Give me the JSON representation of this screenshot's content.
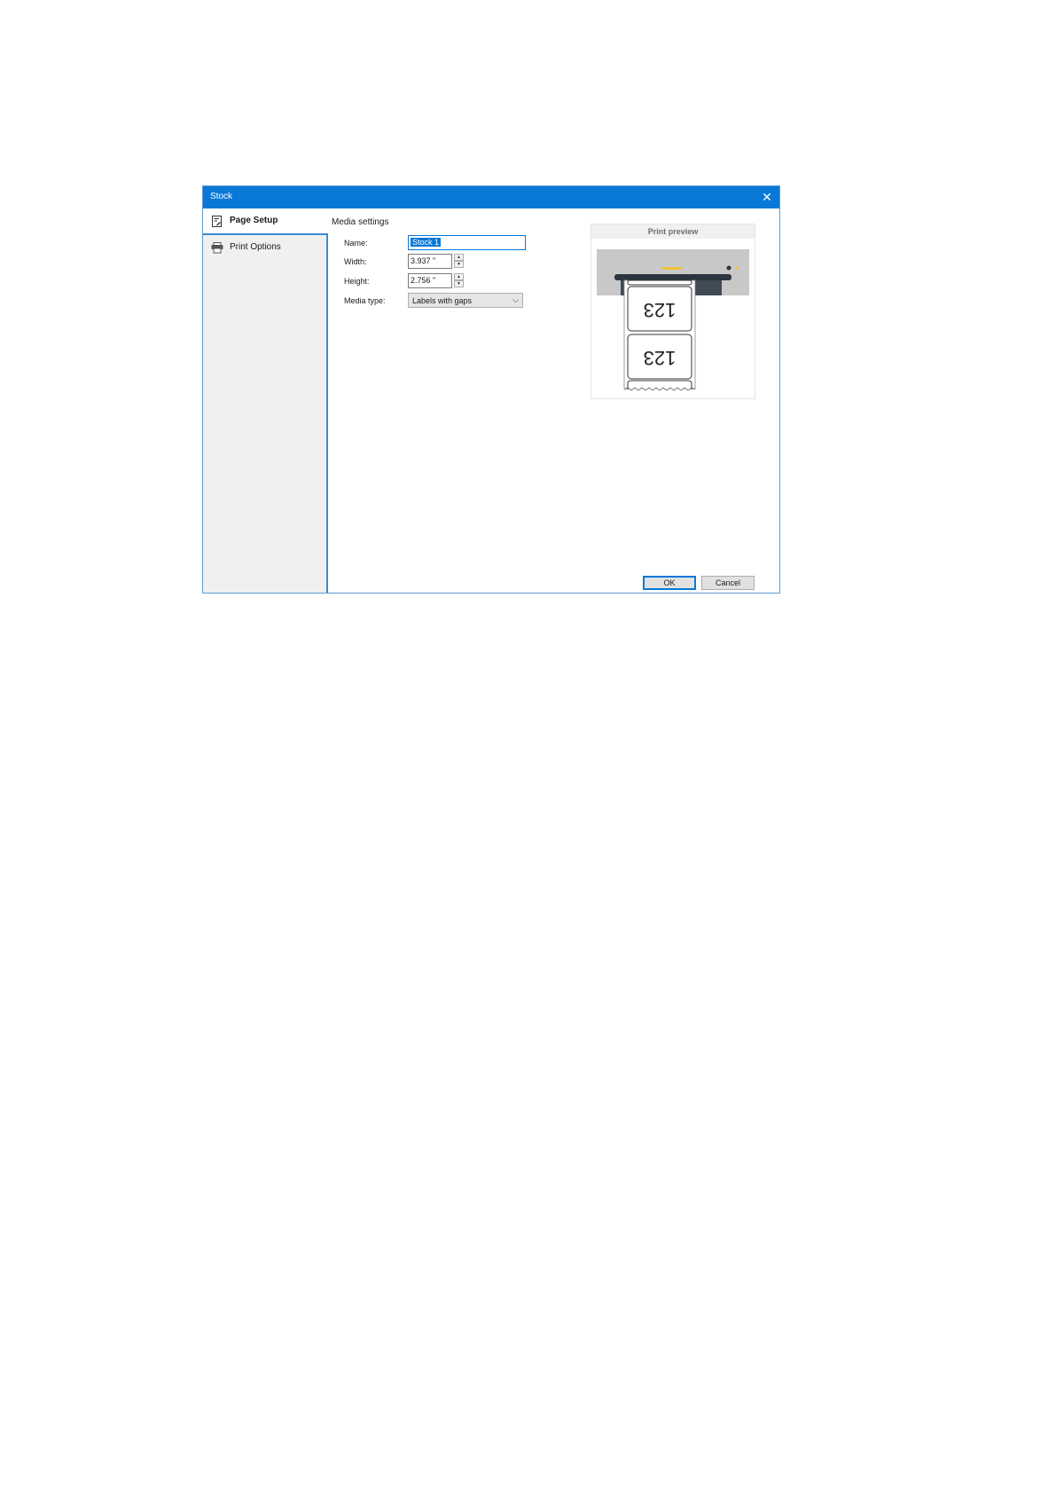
{
  "window": {
    "title": "Stock",
    "close_icon": "close-icon"
  },
  "sidebar": {
    "items": [
      {
        "label": "Page Setup",
        "icon": "page-setup-icon",
        "active": true
      },
      {
        "label": "Print Options",
        "icon": "printer-icon",
        "active": false
      }
    ]
  },
  "media": {
    "section_title": "Media settings",
    "name_label": "Name:",
    "name_value": "Stock 1",
    "width_label": "Width:",
    "width_value": "3.937 \"",
    "height_label": "Height:",
    "height_value": "2.756 \"",
    "media_type_label": "Media type:",
    "media_type_value": "Labels with gaps"
  },
  "preview": {
    "title": "Print preview",
    "label_text": "123"
  },
  "buttons": {
    "ok": "OK",
    "cancel": "Cancel"
  },
  "colors": {
    "accent": "#0a78d7",
    "sidebar_bg": "#f0f0f0",
    "printer_led": "#f2c230"
  }
}
